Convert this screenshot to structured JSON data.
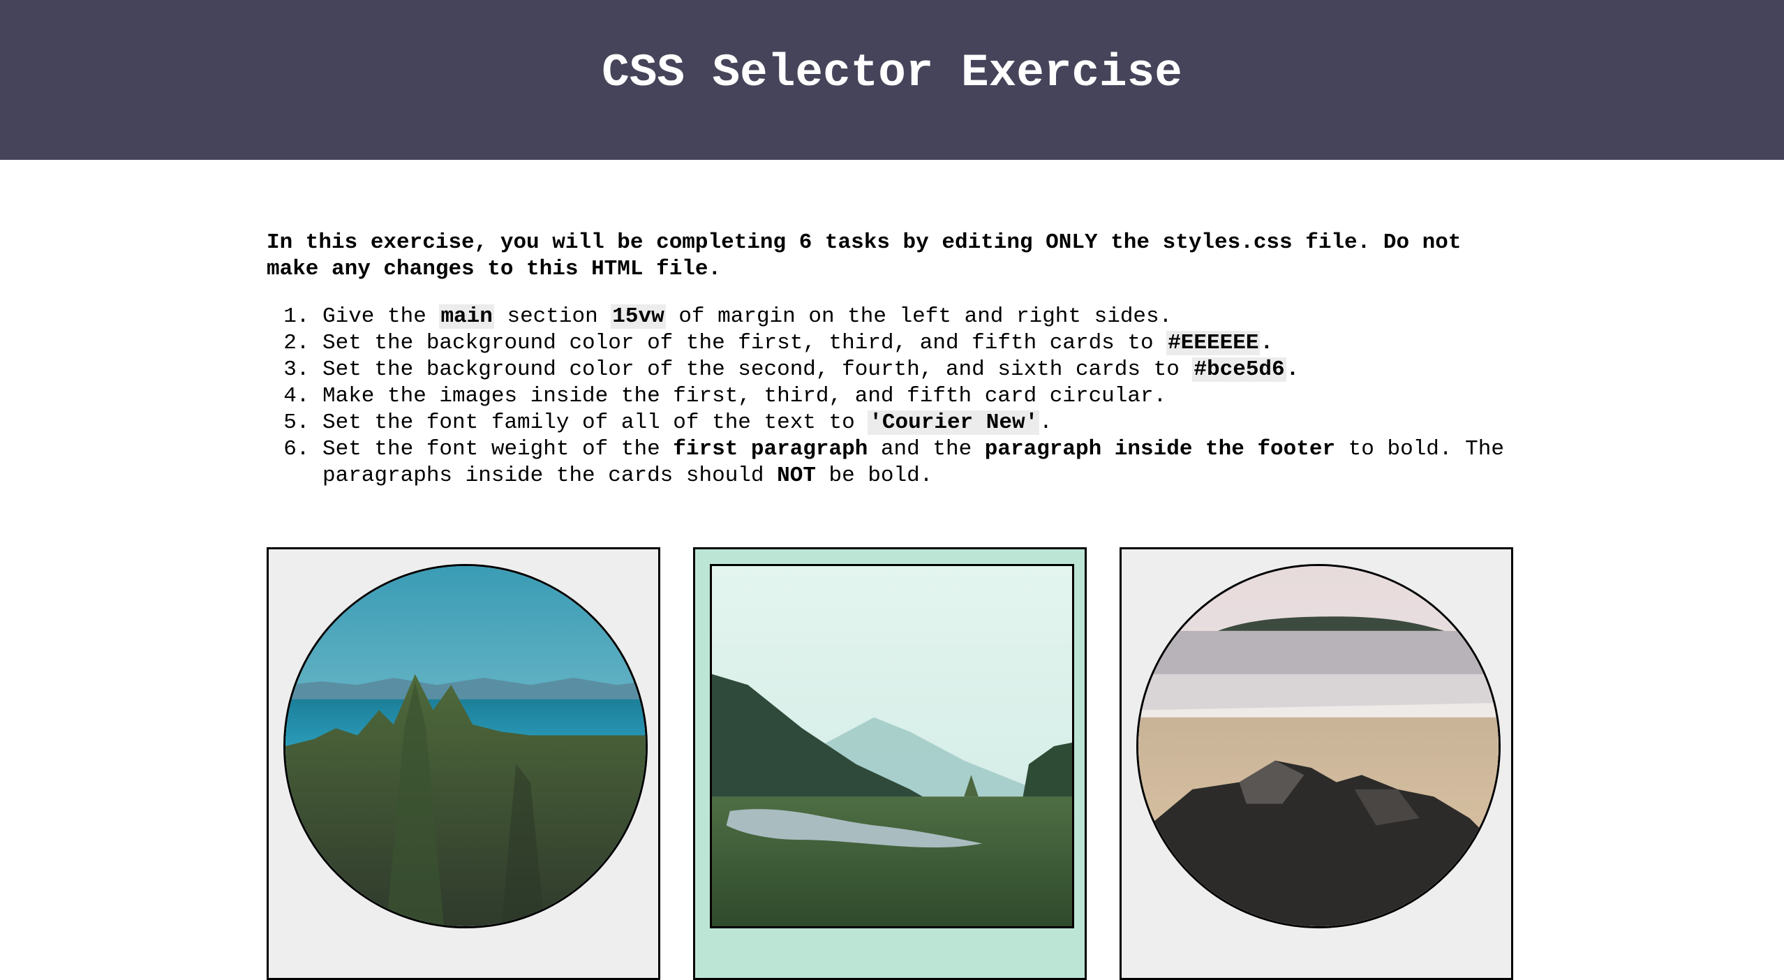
{
  "header": {
    "title": "CSS Selector Exercise"
  },
  "intro": "In this exercise, you will be completing 6 tasks by editing ONLY the styles.css file. Do not make any changes to this HTML file.",
  "tasks": {
    "t1": {
      "a": "Give the ",
      "code1": "main",
      "b": " section ",
      "code2": "15vw",
      "c": " of margin on the left and right sides."
    },
    "t2": {
      "a": "Set the background color of the first, third, and fifth cards to ",
      "code1": "#EEEEEE",
      "b": "."
    },
    "t3": {
      "a": "Set the background color of the second, fourth, and sixth cards to ",
      "code1": "#bce5d6",
      "b": "."
    },
    "t4": {
      "a": "Make the images inside the first, third, and fifth card circular."
    },
    "t5": {
      "a": "Set the font family of all of the text to ",
      "code1": "'Courier New'",
      "b": "."
    },
    "t6": {
      "a": "Set the font weight of the ",
      "bold1": "first paragraph",
      "b": " and the ",
      "bold2": "paragraph inside the footer",
      "c": " to bold. The paragraphs inside the cards should ",
      "bold3": "NOT",
      "d": " be bold."
    }
  },
  "cards": [
    {
      "image": "forest-lake-photo",
      "shape": "circle",
      "background": "#EEEEEE"
    },
    {
      "image": "river-valley-photo",
      "shape": "square",
      "background": "#bce5d6"
    },
    {
      "image": "rocky-beach-photo",
      "shape": "circle",
      "background": "#EEEEEE"
    }
  ],
  "colors": {
    "header_bg": "#45445a",
    "card_odd_bg": "#EEEEEE",
    "card_even_bg": "#bce5d6"
  }
}
